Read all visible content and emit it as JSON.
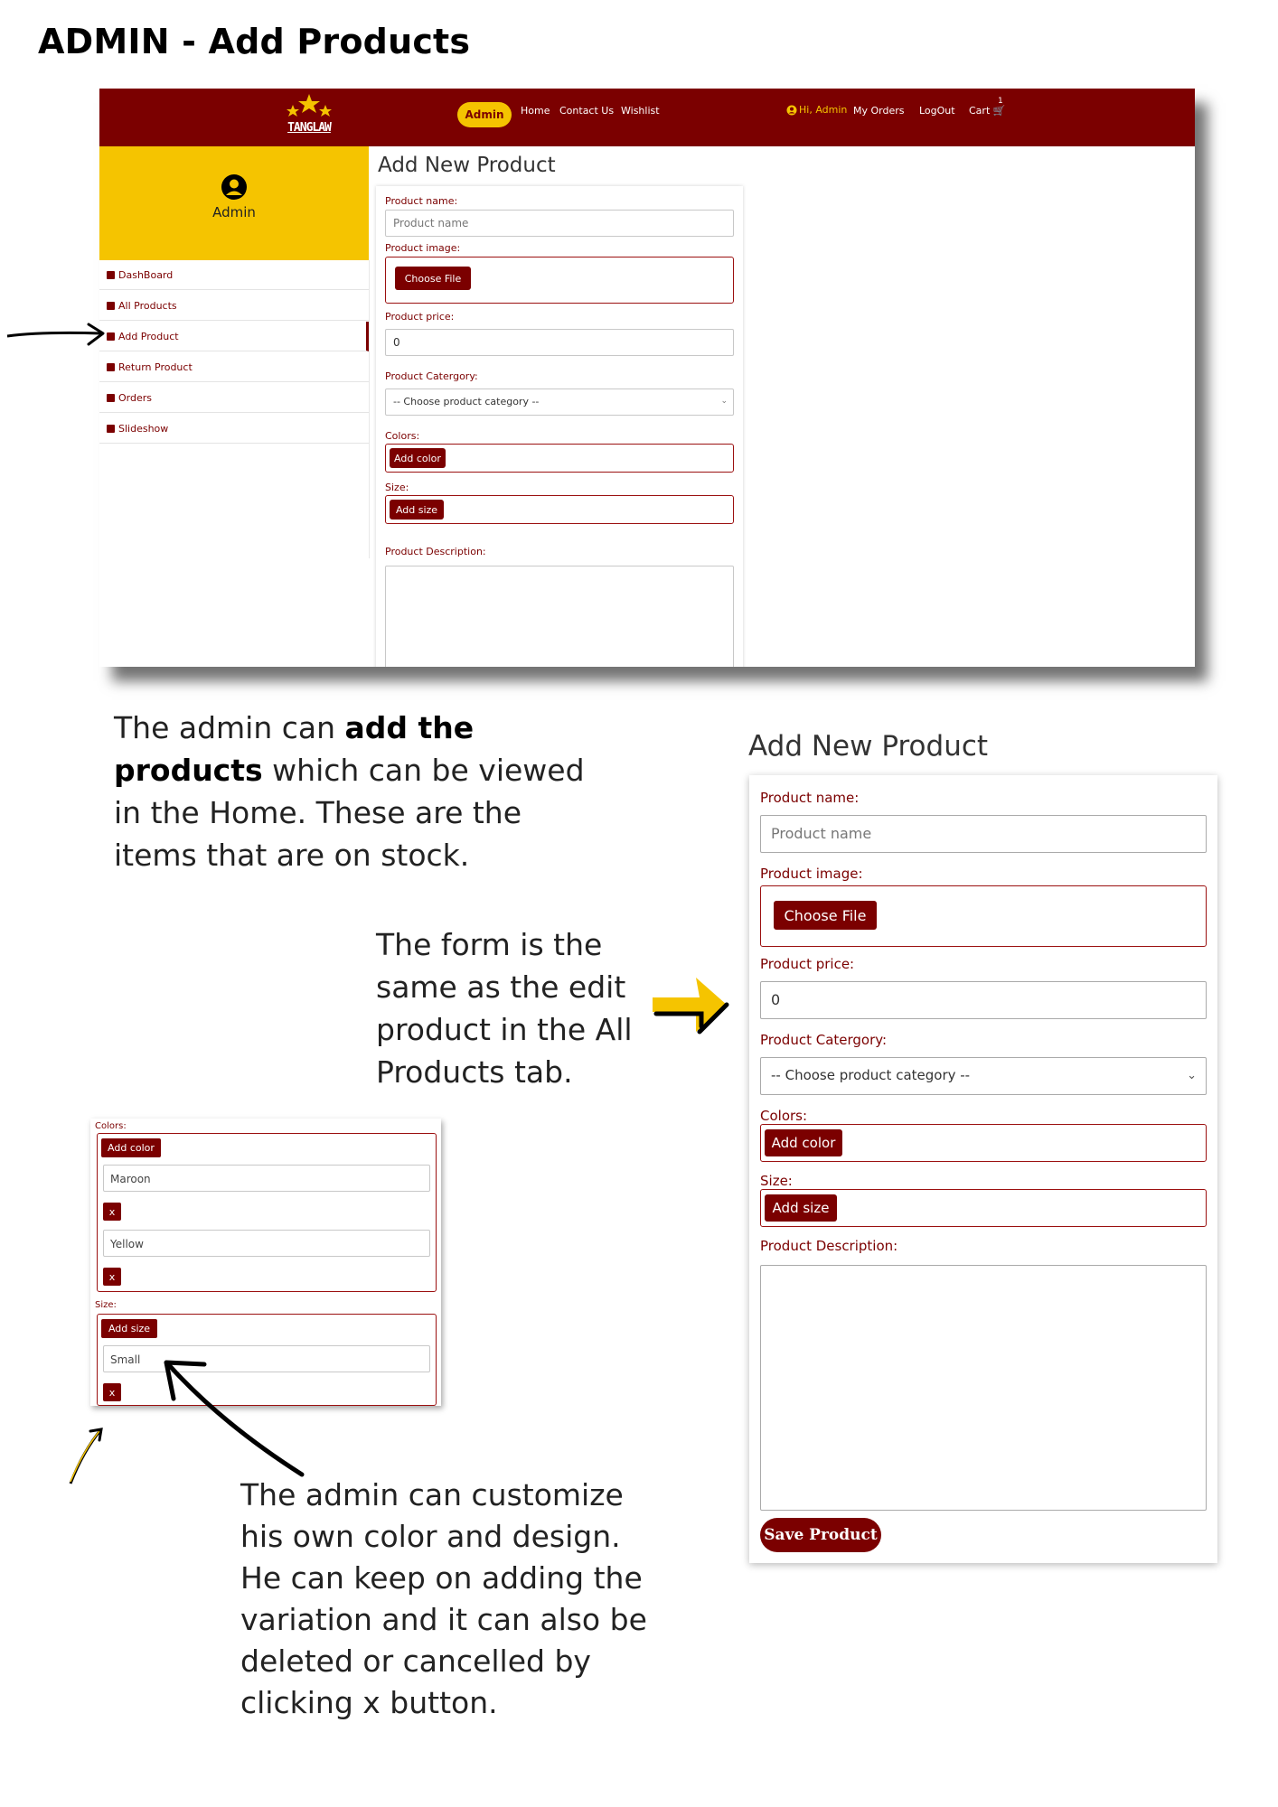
{
  "page": {
    "title": "ADMIN - Add Products"
  },
  "navbar": {
    "logo_text": "TANGLAW",
    "admin_badge": "Admin",
    "links": [
      "Home",
      "Contact Us",
      "Wishlist"
    ],
    "greeting": "Hi, Admin",
    "my_orders": "My Orders",
    "logout": "LogOut",
    "cart": "Cart",
    "cart_count": "1",
    "colors": {
      "bar": "#7b0000",
      "accent": "#f5c400"
    }
  },
  "sidebar": {
    "user_name": "Admin",
    "items": [
      {
        "label": "DashBoard",
        "icon": "dashboard-icon"
      },
      {
        "label": "All Products",
        "icon": "list-icon"
      },
      {
        "label": "Add Product",
        "icon": "box-icon",
        "active": true
      },
      {
        "label": "Return Product",
        "icon": "return-icon"
      },
      {
        "label": "Orders",
        "icon": "clipboard-icon"
      },
      {
        "label": "Slideshow",
        "icon": "slides-icon"
      }
    ]
  },
  "form": {
    "title": "Add New Product",
    "name_label": "Product name:",
    "name_placeholder": "Product name",
    "image_label": "Product image:",
    "choose_file": "Choose File",
    "price_label": "Product price:",
    "price_value": "0",
    "category_label": "Product Catergory:",
    "category_selected": "-- Choose product category --",
    "colors_label": "Colors:",
    "add_color": "Add color",
    "size_label": "Size:",
    "add_size": "Add size",
    "description_label": "Product Description:",
    "save_button": "Save Product"
  },
  "variations": {
    "colors_label": "Colors:",
    "add_color": "Add color",
    "color_values": [
      "Maroon",
      "Yellow"
    ],
    "remove_label": "x",
    "size_label": "Size:",
    "add_size": "Add size",
    "size_values": [
      "Small"
    ]
  },
  "annotations": {
    "intro": {
      "part1": "The admin can ",
      "bold1": "add the",
      "bold2": "products",
      "part2": " which can be viewed",
      "line3": "in the Home. These are the",
      "line4": "items that are on stock."
    },
    "form_note": [
      "The form is the",
      "same as the edit",
      "product in the All",
      "Products tab."
    ],
    "custom_note": [
      "The admin can customize",
      "his own color and design.",
      "He can keep on adding the",
      "variation and it can also be",
      "deleted or cancelled by",
      "clicking x button."
    ]
  }
}
